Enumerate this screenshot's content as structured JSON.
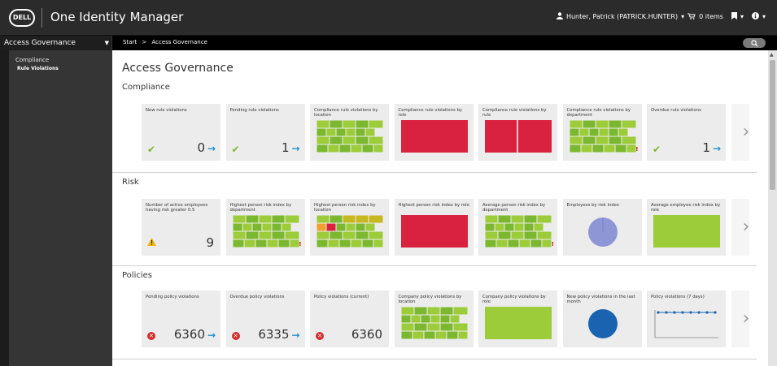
{
  "header": {
    "logo_text": "DELL",
    "app_title": "One Identity Manager",
    "user": "Hunter, Patrick (PATRICK.HUNTER)",
    "cart": "0 items"
  },
  "nav": {
    "module": "Access Governance",
    "breadcrumb": [
      "Start",
      ">",
      "Access Governance"
    ]
  },
  "sidebar": {
    "items": [
      {
        "label": "Compliance"
      },
      {
        "label": "Rule Violations"
      }
    ]
  },
  "page": {
    "title": "Access Governance",
    "sections": [
      {
        "title": "Compliance",
        "tiles": [
          {
            "label": "New rule violations",
            "kind": "number",
            "value": "0",
            "icon": "check-icon",
            "arrow": true
          },
          {
            "label": "Pending rule violations",
            "kind": "number",
            "value": "1",
            "icon": "check-icon",
            "arrow": true
          },
          {
            "label": "Compliance rule violations by location",
            "kind": "treemap",
            "mark": false
          },
          {
            "label": "Compliance rule violations by role",
            "kind": "redblock",
            "split": false
          },
          {
            "label": "Compliance rule violations by rule",
            "kind": "redblock",
            "split": true
          },
          {
            "label": "Compliance rule violations by department",
            "kind": "treemap",
            "mark": true
          },
          {
            "label": "Overdue rule violations",
            "kind": "number",
            "value": "1",
            "icon": "check-icon",
            "arrow": true
          }
        ]
      },
      {
        "title": "Risk",
        "tiles": [
          {
            "label": "Number of active employees having risk greater 0.5",
            "kind": "number",
            "value": "9",
            "icon": "warning-icon",
            "arrow": false
          },
          {
            "label": "Highest person risk index by department",
            "kind": "treemap",
            "mark": true
          },
          {
            "label": "Highest person risk index by location",
            "kind": "treemap-risk",
            "mark": false
          },
          {
            "label": "Highest person risk index by role",
            "kind": "redblock",
            "split": false
          },
          {
            "label": "Average person risk index by department",
            "kind": "treemap",
            "mark": true
          },
          {
            "label": "Employees by risk index",
            "kind": "pie"
          },
          {
            "label": "Average employee risk index by role",
            "kind": "greenblock"
          }
        ]
      },
      {
        "title": "Policies",
        "tiles": [
          {
            "label": "Pending policy violations",
            "kind": "number",
            "value": "6360",
            "icon": "error-icon",
            "arrow": true
          },
          {
            "label": "Overdue policy violations",
            "kind": "number",
            "value": "6335",
            "icon": "error-icon",
            "arrow": true
          },
          {
            "label": "Policy violations (current)",
            "kind": "number",
            "value": "6360",
            "icon": "error-icon",
            "arrow": false
          },
          {
            "label": "Company policy violations by location",
            "kind": "treemap",
            "mark": false
          },
          {
            "label": "Company policy violations by role",
            "kind": "greenblock"
          },
          {
            "label": "New policy violations in the last month",
            "kind": "circle"
          },
          {
            "label": "Policy violations (7 days)",
            "kind": "line"
          }
        ]
      }
    ]
  },
  "colors": {
    "header_bg": "#2b2b2b",
    "tile_bg": "#ececec",
    "check": "#7cb82f",
    "arrow": "#1e8fc6",
    "error": "#d32f2f",
    "treemap_green": "#8bc34a",
    "risk_red": "#d9223f",
    "pie": "#8e96d6",
    "circle": "#1a63b0",
    "line": "#1a63b0"
  }
}
